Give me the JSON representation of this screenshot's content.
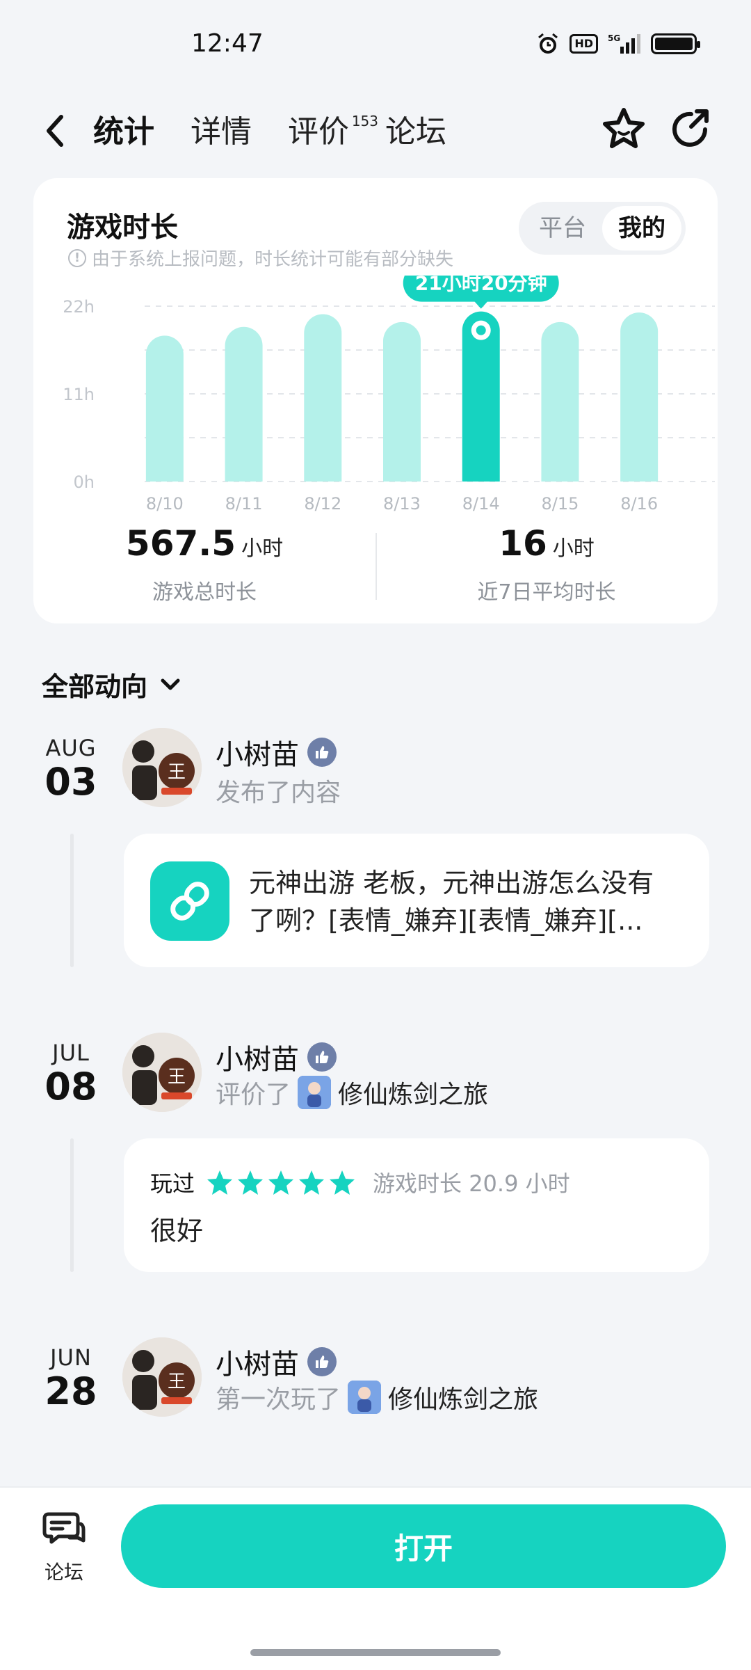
{
  "status_bar": {
    "time": "12:47",
    "hd": "HD",
    "network": "5G"
  },
  "nav": {
    "tabs": [
      {
        "label": "统计",
        "active": true
      },
      {
        "label": "详情"
      },
      {
        "label": "评价",
        "badge": "153"
      },
      {
        "label": "论坛"
      }
    ]
  },
  "stats": {
    "title": "游戏时长",
    "note": "由于系统上报问题，时长统计可能有部分缺失",
    "toggle": [
      "平台",
      "我的"
    ],
    "toggle_active": "我的",
    "total_value": "567.5",
    "total_unit": "小时",
    "total_label": "游戏总时长",
    "avg_value": "16",
    "avg_unit": "小时",
    "avg_label": "近7日平均时长"
  },
  "chart_data": {
    "type": "bar",
    "categories": [
      "8/10",
      "8/11",
      "8/12",
      "8/13",
      "8/14",
      "8/15",
      "8/16"
    ],
    "values": [
      18.3,
      19.4,
      21.0,
      20.0,
      21.33,
      20.0,
      21.2
    ],
    "y_tick_labels": [
      "0h",
      "11h",
      "22h"
    ],
    "ylim": [
      0,
      22
    ],
    "highlight_index": 4,
    "highlight_label": "21小时20分钟",
    "bar_color": "#b4f1ea",
    "highlight_color": "#16d3c0",
    "grid": "dashed horizontal"
  },
  "feed": {
    "header": "全部动向",
    "items": [
      {
        "month": "AUG",
        "day": "03",
        "user": "小树苗",
        "action": "发布了内容",
        "post": "元神出游 老板，元神出游怎么没有了咧？[表情_嫌弃][表情_嫌弃][..."
      },
      {
        "month": "JUL",
        "day": "08",
        "user": "小树苗",
        "action": "评价了",
        "game": "修仙炼剑之旅",
        "review_played": "玩过",
        "rating": 5,
        "review_meta": "游戏时长 20.9 小时",
        "review_text": "很好"
      },
      {
        "month": "JUN",
        "day": "28",
        "user": "小树苗",
        "action": "第一次玩了",
        "game": "修仙炼剑之旅"
      }
    ]
  },
  "bottom": {
    "forum_label": "论坛",
    "open_label": "打开"
  },
  "colors": {
    "accent": "#16d3c0",
    "background": "#f3f5f8"
  }
}
